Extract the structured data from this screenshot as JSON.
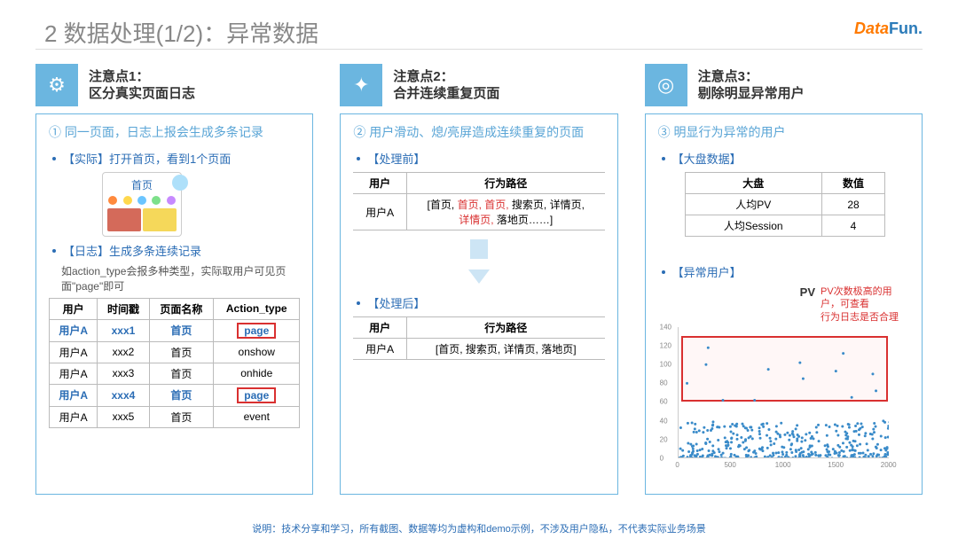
{
  "title": "2 数据处理(1/2)：异常数据",
  "logo": {
    "prefix": "Data",
    "suffix": "Fun.",
    "full": "DataFun."
  },
  "notes": [
    {
      "label": "注意点1：",
      "desc": "区分真实页面日志",
      "icon": "gear"
    },
    {
      "label": "注意点2：",
      "desc": "合并连续重复页面",
      "icon": "puzzle"
    },
    {
      "label": "注意点3：",
      "desc": "剔除明显异常用户",
      "icon": "target"
    }
  ],
  "card1": {
    "title": "① 同一页面，日志上报会生成多条记录",
    "b1": "【实际】打开首页，看到1个页面",
    "phone_tab": "首页",
    "b2": "【日志】生成多条连续记录",
    "sub": "如action_type会报多种类型，实际取用户可见页面\"page\"即可",
    "headers": [
      "用户",
      "时间戳",
      "页面名称",
      "Action_type"
    ],
    "rows": [
      {
        "u": "用户A",
        "t": "xxx1",
        "p": "首页",
        "a": "page",
        "hl": true,
        "box": true
      },
      {
        "u": "用户A",
        "t": "xxx2",
        "p": "首页",
        "a": "onshow"
      },
      {
        "u": "用户A",
        "t": "xxx3",
        "p": "首页",
        "a": "onhide"
      },
      {
        "u": "用户A",
        "t": "xxx4",
        "p": "首页",
        "a": "page",
        "hl": true,
        "box": true
      },
      {
        "u": "用户A",
        "t": "xxx5",
        "p": "首页",
        "a": "event"
      }
    ]
  },
  "card2": {
    "title": "② 用户滑动、熄/亮屏造成连续重复的页面",
    "before_label": "【处理前】",
    "after_label": "【处理后】",
    "th_user": "用户",
    "th_path": "行为路径",
    "user": "用户A",
    "path_before_parts": [
      "[首页, ",
      "首页, 首页, ",
      "搜索页, 详情页, ",
      "详情页, ",
      "落地页……]"
    ],
    "path_after": "[首页, 搜索页, 详情页, 落地页]"
  },
  "card3": {
    "title": "③ 明显行为异常的用户",
    "b1": "【大盘数据】",
    "th_metric": "大盘",
    "th_value": "数值",
    "metrics": [
      {
        "m": "人均PV",
        "v": "28"
      },
      {
        "m": "人均Session",
        "v": "4"
      }
    ],
    "b2": "【异常用户】",
    "pv_label": "PV",
    "red_note1": "PV次数极高的用户，可查看",
    "red_note2": "行为日志是否合理"
  },
  "chart_data": {
    "type": "scatter",
    "xlabel": "",
    "ylabel": "",
    "xlim": [
      0,
      2000
    ],
    "ylim": [
      0,
      140
    ],
    "x_ticks": [
      0,
      500,
      1000,
      1500,
      2000
    ],
    "y_ticks": [
      0,
      20,
      40,
      60,
      80,
      100,
      120,
      140
    ],
    "highlight_zone": {
      "x0": 30,
      "x1": 1990,
      "y0": 60,
      "y1": 130
    },
    "dense_band": {
      "y_max": 40,
      "count_approx": 400
    },
    "outliers_approx": [
      {
        "x": 80,
        "y": 80
      },
      {
        "x": 280,
        "y": 118
      },
      {
        "x": 260,
        "y": 100
      },
      {
        "x": 420,
        "y": 62
      },
      {
        "x": 720,
        "y": 62
      },
      {
        "x": 850,
        "y": 95
      },
      {
        "x": 1180,
        "y": 85
      },
      {
        "x": 1150,
        "y": 102
      },
      {
        "x": 1490,
        "y": 93
      },
      {
        "x": 1560,
        "y": 112
      },
      {
        "x": 1640,
        "y": 65
      },
      {
        "x": 1840,
        "y": 90
      },
      {
        "x": 1870,
        "y": 72
      }
    ]
  },
  "footer": "说明：技术分享和学习，所有截图、数据等均为虚构和demo示例，不涉及用户隐私，不代表实际业务场景"
}
